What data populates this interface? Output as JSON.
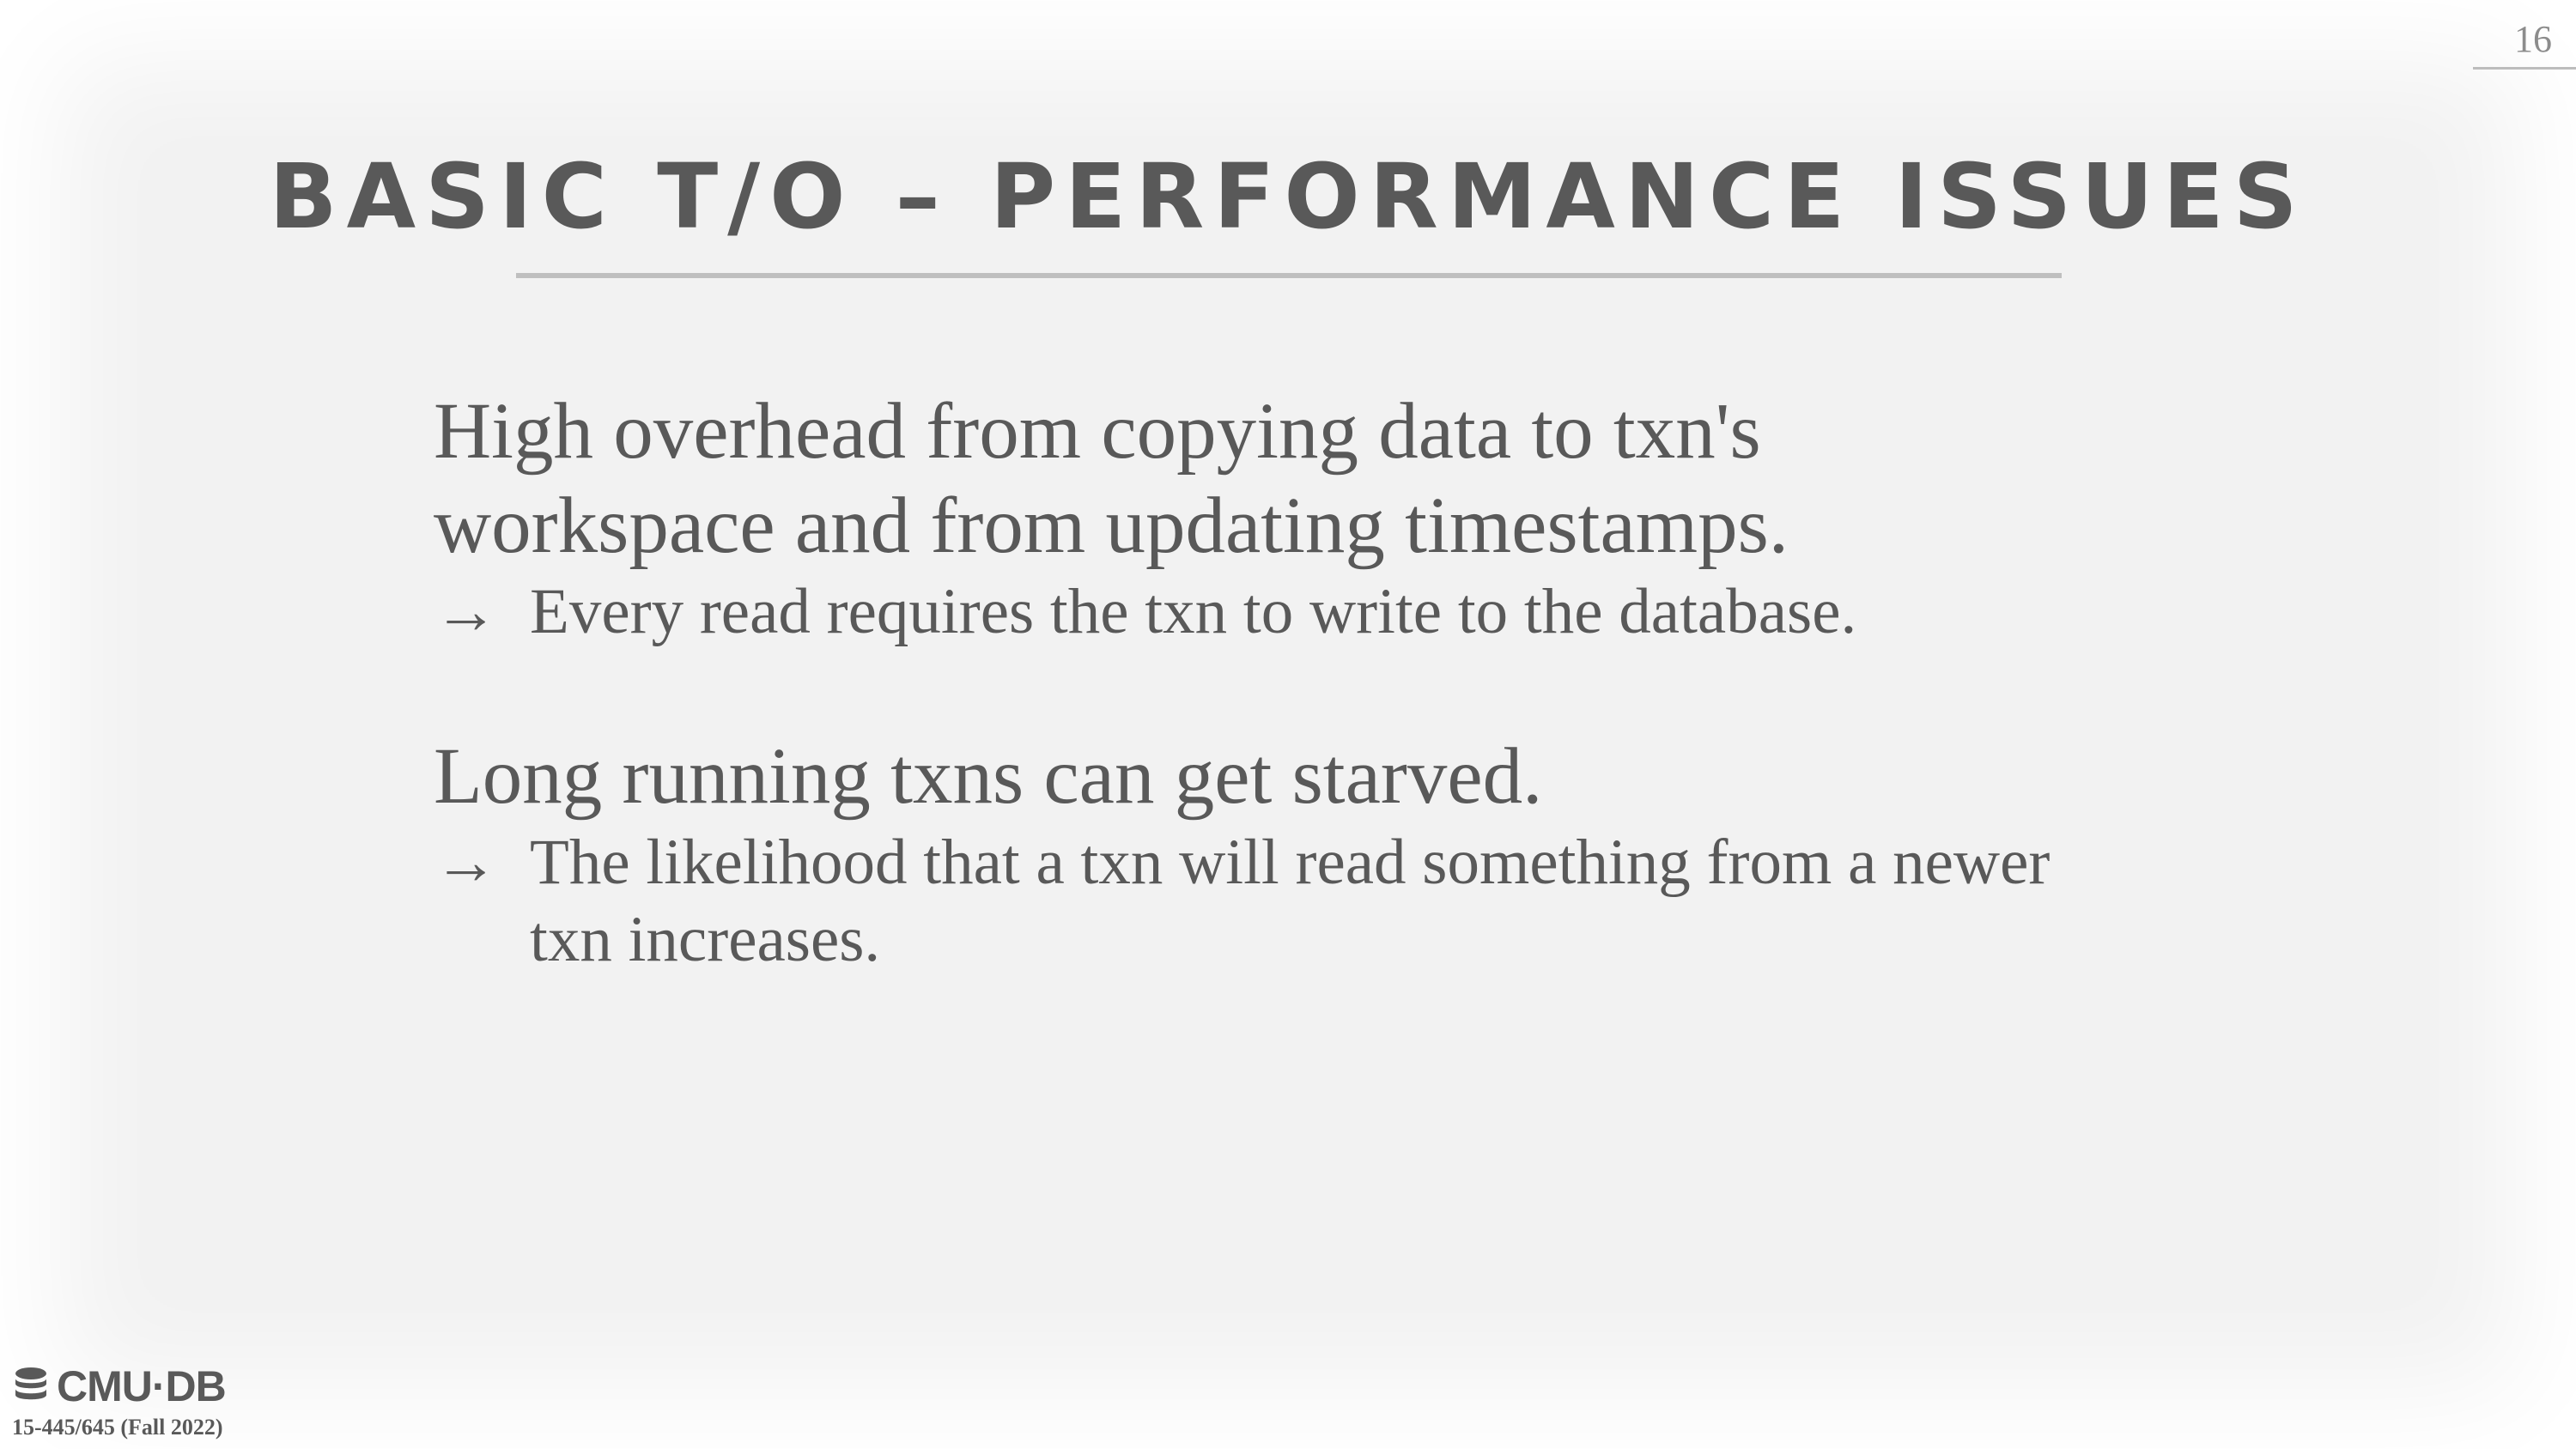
{
  "slide": {
    "page_number": "16",
    "title": "BASIC T/O – PERFORMANCE ISSUES",
    "bullets": [
      {
        "lines": [
          "High overhead from copying data to txn's",
          "workspace and from updating timestamps."
        ],
        "sub": {
          "arrow": "→",
          "text": "Every read requires the txn to write to the database."
        }
      },
      {
        "lines": [
          "Long running txns can get starved."
        ],
        "sub": {
          "arrow": "→",
          "text": "The likelihood that a txn will read something from a newer txn increases."
        }
      }
    ]
  },
  "footer": {
    "logo_icon": "database-icon",
    "logo_text": "CMU·DB",
    "course": "15-445/645 (Fall 2022)"
  },
  "colors": {
    "background": "#f2f2f2",
    "text": "#595959",
    "rule": "#bfbfbf"
  }
}
